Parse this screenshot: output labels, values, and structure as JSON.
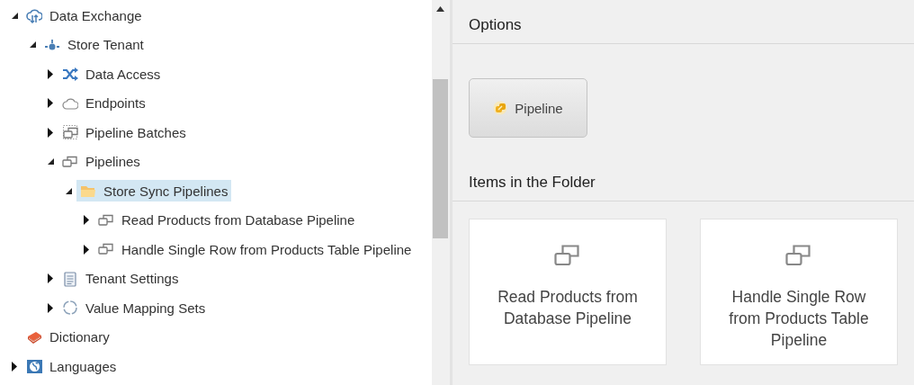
{
  "tree": [
    {
      "label": "Data Exchange",
      "kind": "exchange",
      "expandable": true,
      "expanded": true,
      "selected": false,
      "children": [
        {
          "label": "Store Tenant",
          "kind": "tenant",
          "expandable": true,
          "expanded": true,
          "selected": false,
          "children": [
            {
              "label": "Data Access",
              "kind": "shuffle",
              "expandable": true,
              "expanded": false,
              "selected": false
            },
            {
              "label": "Endpoints",
              "kind": "cloud",
              "expandable": true,
              "expanded": false,
              "selected": false
            },
            {
              "label": "Pipeline Batches",
              "kind": "batch",
              "expandable": true,
              "expanded": false,
              "selected": false
            },
            {
              "label": "Pipelines",
              "kind": "pipeline",
              "expandable": true,
              "expanded": true,
              "selected": false,
              "children": [
                {
                  "label": "Store Sync Pipelines",
                  "kind": "folder",
                  "expandable": true,
                  "expanded": true,
                  "selected": true,
                  "children": [
                    {
                      "label": "Read Products from Database Pipeline",
                      "kind": "pipeline",
                      "expandable": true,
                      "expanded": false,
                      "selected": false
                    },
                    {
                      "label": "Handle Single Row from Products Table Pipeline",
                      "kind": "pipeline",
                      "expandable": true,
                      "expanded": false,
                      "selected": false
                    }
                  ]
                }
              ]
            },
            {
              "label": "Tenant Settings",
              "kind": "settings",
              "expandable": true,
              "expanded": false,
              "selected": false
            },
            {
              "label": "Value Mapping Sets",
              "kind": "mapping",
              "expandable": true,
              "expanded": false,
              "selected": false
            }
          ]
        }
      ]
    },
    {
      "label": "Dictionary",
      "kind": "dictionary",
      "expandable": false,
      "selected": false
    },
    {
      "label": "Languages",
      "kind": "globe",
      "expandable": true,
      "expanded": false,
      "selected": false
    }
  ],
  "options": {
    "title": "Options",
    "buttons": [
      {
        "label": "Pipeline"
      }
    ]
  },
  "folder": {
    "title": "Items in the Folder",
    "items": [
      {
        "label": "Read Products from Database Pipeline"
      },
      {
        "label": "Handle Single Row from Products Table Pipeline"
      }
    ]
  }
}
